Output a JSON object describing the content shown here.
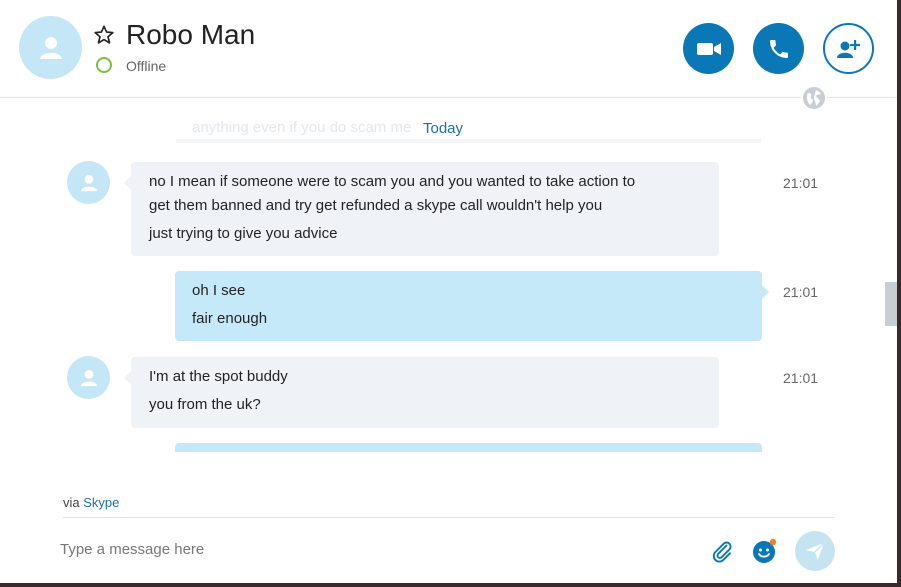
{
  "header": {
    "contact_name": "Robo Man",
    "status": "Offline",
    "icons": {
      "avatar": "user-icon",
      "favorite": "star-icon",
      "video": "video-camera-icon",
      "call": "phone-icon",
      "add": "add-person-icon",
      "globe": "globe-icon"
    }
  },
  "chat": {
    "faded_text": "anything even if you do scam me",
    "day_separator": "Today",
    "messages": [
      {
        "direction": "incoming",
        "time": "21:01",
        "lines": [
          "no I mean if someone were to scam you and you wanted to take action to",
          "get them banned and try get refunded a skype call wouldn't help you",
          "just trying to give you advice"
        ]
      },
      {
        "direction": "outgoing",
        "time": "21:01",
        "lines": [
          "oh I see",
          "fair enough"
        ]
      },
      {
        "direction": "incoming",
        "time": "21:01",
        "lines": [
          "I'm at the spot buddy",
          "you from the uk?"
        ]
      }
    ]
  },
  "footer": {
    "via_prefix": "via",
    "via_link": "Skype",
    "input_placeholder": "Type a message here",
    "icons": {
      "attach": "paperclip-icon",
      "emoji": "emoji-icon",
      "send": "send-icon"
    }
  },
  "colors": {
    "accent": "#0a78b6",
    "incoming_bubble": "#eff2f7",
    "outgoing_bubble": "#c6e9fa",
    "status_offline": "#7cbf3a"
  }
}
